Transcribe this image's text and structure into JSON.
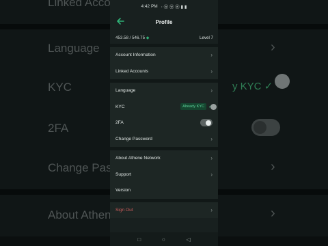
{
  "status_bar": {
    "time": "4:42 PM",
    "icons": "⋅ ⓦ ⓦ ⓦ ▮ ▮"
  },
  "header": {
    "title": "Profile"
  },
  "balance": {
    "amount": "453.58 / 546.75",
    "level": "Level 7"
  },
  "menu": {
    "account_information": "Account Information",
    "linked_accounts": "Linked Accounts",
    "language": "Language",
    "kyc": "KYC",
    "kyc_status": "Already KYC",
    "two_fa": "2FA",
    "two_fa_enabled": false,
    "change_password": "Change Password",
    "about": "About Athene Network",
    "support": "Support",
    "version": "Version",
    "sign_out": "Sign Out"
  },
  "background": {
    "linked": "Linked Accounts",
    "language": "Language",
    "kyc": "KYC",
    "kyc_status": "y KYC",
    "two_fa": "2FA",
    "change": "Change Password",
    "about": "About Athene Network"
  },
  "colors": {
    "accent": "#2fb076",
    "danger": "#cf5d5d",
    "background": "#18201f"
  },
  "icons": {
    "back": "arrow-left-icon",
    "chevron": "chevron-right-icon",
    "check": "check-icon"
  }
}
